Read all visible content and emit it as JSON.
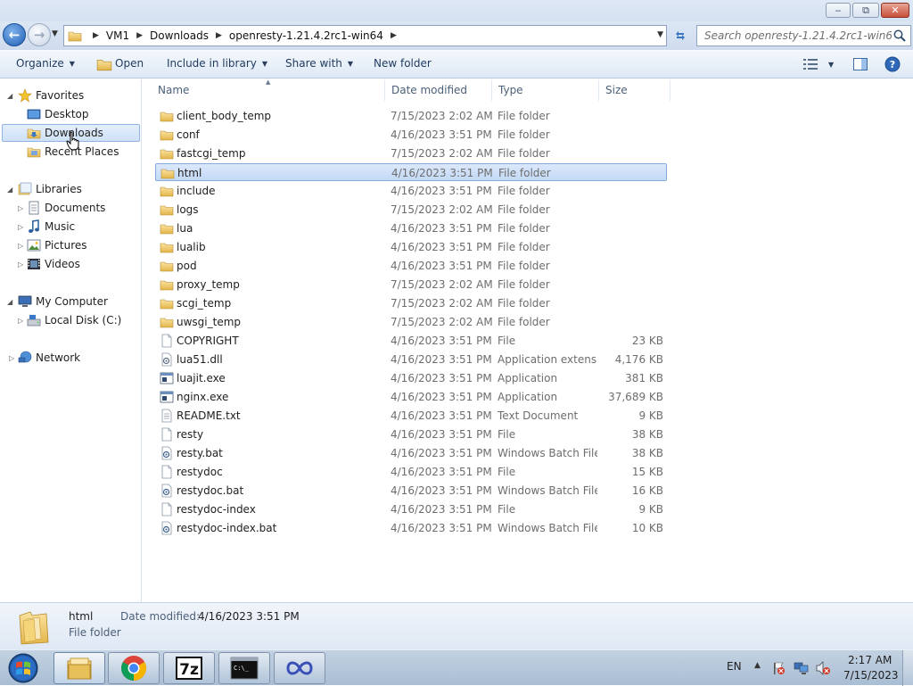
{
  "window": {
    "controls": {
      "minimize": "‒",
      "maximize": "⧉",
      "close": "✕"
    }
  },
  "address": {
    "crumbs": [
      "VM1",
      "Downloads",
      "openresty-1.21.4.2rc1-win64"
    ],
    "search_placeholder": "Search openresty-1.21.4.2rc1-win64"
  },
  "toolbar": {
    "organize": "Organize",
    "open": "Open",
    "include_in_library": "Include in library",
    "share_with": "Share with",
    "new_folder": "New folder"
  },
  "nav": {
    "favorites": "Favorites",
    "desktop": "Desktop",
    "downloads": "Downloads",
    "recent_places": "Recent Places",
    "libraries": "Libraries",
    "documents": "Documents",
    "music": "Music",
    "pictures": "Pictures",
    "videos": "Videos",
    "my_computer": "My Computer",
    "local_disk": "Local Disk (C:)",
    "network": "Network"
  },
  "columns": {
    "name": "Name",
    "date": "Date modified",
    "type": "Type",
    "size": "Size"
  },
  "files": [
    {
      "name": "client_body_temp",
      "date": "7/15/2023 2:02 AM",
      "type": "File folder",
      "size": "",
      "icon": "folder-icon"
    },
    {
      "name": "conf",
      "date": "4/16/2023 3:51 PM",
      "type": "File folder",
      "size": "",
      "icon": "folder-icon"
    },
    {
      "name": "fastcgi_temp",
      "date": "7/15/2023 2:02 AM",
      "type": "File folder",
      "size": "",
      "icon": "folder-icon"
    },
    {
      "name": "html",
      "date": "4/16/2023 3:51 PM",
      "type": "File folder",
      "size": "",
      "icon": "folder-icon"
    },
    {
      "name": "include",
      "date": "4/16/2023 3:51 PM",
      "type": "File folder",
      "size": "",
      "icon": "folder-icon"
    },
    {
      "name": "logs",
      "date": "7/15/2023 2:02 AM",
      "type": "File folder",
      "size": "",
      "icon": "folder-icon"
    },
    {
      "name": "lua",
      "date": "4/16/2023 3:51 PM",
      "type": "File folder",
      "size": "",
      "icon": "folder-icon"
    },
    {
      "name": "lualib",
      "date": "4/16/2023 3:51 PM",
      "type": "File folder",
      "size": "",
      "icon": "folder-icon"
    },
    {
      "name": "pod",
      "date": "4/16/2023 3:51 PM",
      "type": "File folder",
      "size": "",
      "icon": "folder-icon"
    },
    {
      "name": "proxy_temp",
      "date": "7/15/2023 2:02 AM",
      "type": "File folder",
      "size": "",
      "icon": "folder-icon"
    },
    {
      "name": "scgi_temp",
      "date": "7/15/2023 2:02 AM",
      "type": "File folder",
      "size": "",
      "icon": "folder-icon"
    },
    {
      "name": "uwsgi_temp",
      "date": "7/15/2023 2:02 AM",
      "type": "File folder",
      "size": "",
      "icon": "folder-icon"
    },
    {
      "name": "COPYRIGHT",
      "date": "4/16/2023 3:51 PM",
      "type": "File",
      "size": "23 KB",
      "icon": "file-icon"
    },
    {
      "name": "lua51.dll",
      "date": "4/16/2023 3:51 PM",
      "type": "Application extens...",
      "size": "4,176 KB",
      "icon": "dll-icon"
    },
    {
      "name": "luajit.exe",
      "date": "4/16/2023 3:51 PM",
      "type": "Application",
      "size": "381 KB",
      "icon": "exe-icon"
    },
    {
      "name": "nginx.exe",
      "date": "4/16/2023 3:51 PM",
      "type": "Application",
      "size": "37,689 KB",
      "icon": "exe-icon"
    },
    {
      "name": "README.txt",
      "date": "4/16/2023 3:51 PM",
      "type": "Text Document",
      "size": "9 KB",
      "icon": "text-file-icon"
    },
    {
      "name": "resty",
      "date": "4/16/2023 3:51 PM",
      "type": "File",
      "size": "38 KB",
      "icon": "file-icon"
    },
    {
      "name": "resty.bat",
      "date": "4/16/2023 3:51 PM",
      "type": "Windows Batch File",
      "size": "38 KB",
      "icon": "batch-file-icon"
    },
    {
      "name": "restydoc",
      "date": "4/16/2023 3:51 PM",
      "type": "File",
      "size": "15 KB",
      "icon": "file-icon"
    },
    {
      "name": "restydoc.bat",
      "date": "4/16/2023 3:51 PM",
      "type": "Windows Batch File",
      "size": "16 KB",
      "icon": "batch-file-icon"
    },
    {
      "name": "restydoc-index",
      "date": "4/16/2023 3:51 PM",
      "type": "File",
      "size": "9 KB",
      "icon": "file-icon"
    },
    {
      "name": "restydoc-index.bat",
      "date": "4/16/2023 3:51 PM",
      "type": "Windows Batch File",
      "size": "10 KB",
      "icon": "batch-file-icon"
    }
  ],
  "selected_index": 3,
  "details": {
    "name": "html",
    "date_label": "Date modified:",
    "date_value": "4/16/2023 3:51 PM",
    "type": "File folder"
  },
  "taskbar": {
    "language": "EN",
    "time": "2:17 AM",
    "date": "7/15/2023",
    "cmd_text": "C:\\_"
  },
  "colors": {
    "accent": "#3b78c2",
    "selection": "#cfe1f8",
    "folder": "#e8c05a"
  }
}
